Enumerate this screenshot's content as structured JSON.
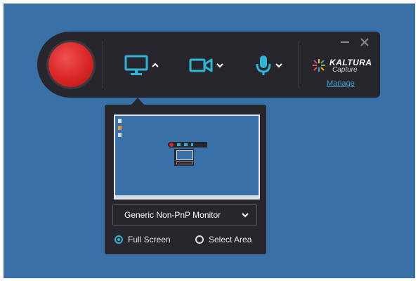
{
  "app": {
    "brand_word": "KALTURA",
    "brand_sub": "Capture",
    "manage_label": "Manage"
  },
  "toolbar": {
    "record_button": "record",
    "sources": [
      {
        "name": "screen",
        "icon": "monitor-icon",
        "caret": "up",
        "active": true
      },
      {
        "name": "camera",
        "icon": "camera-icon",
        "caret": "down",
        "active": false
      },
      {
        "name": "microphone",
        "icon": "microphone-icon",
        "caret": "down",
        "active": false
      }
    ],
    "window_controls": [
      "minimize-icon",
      "close-icon"
    ]
  },
  "screen_panel": {
    "monitor_selected": "Generic Non-PnP Monitor",
    "capture_modes": [
      {
        "label": "Full Screen",
        "selected": true
      },
      {
        "label": "Select Area",
        "selected": false
      }
    ]
  },
  "colors": {
    "accent": "#2fb6d6",
    "bar_bg": "#26262c",
    "desktop": "#3a70a8",
    "record": "#d92525",
    "link": "#3ea0c8"
  }
}
